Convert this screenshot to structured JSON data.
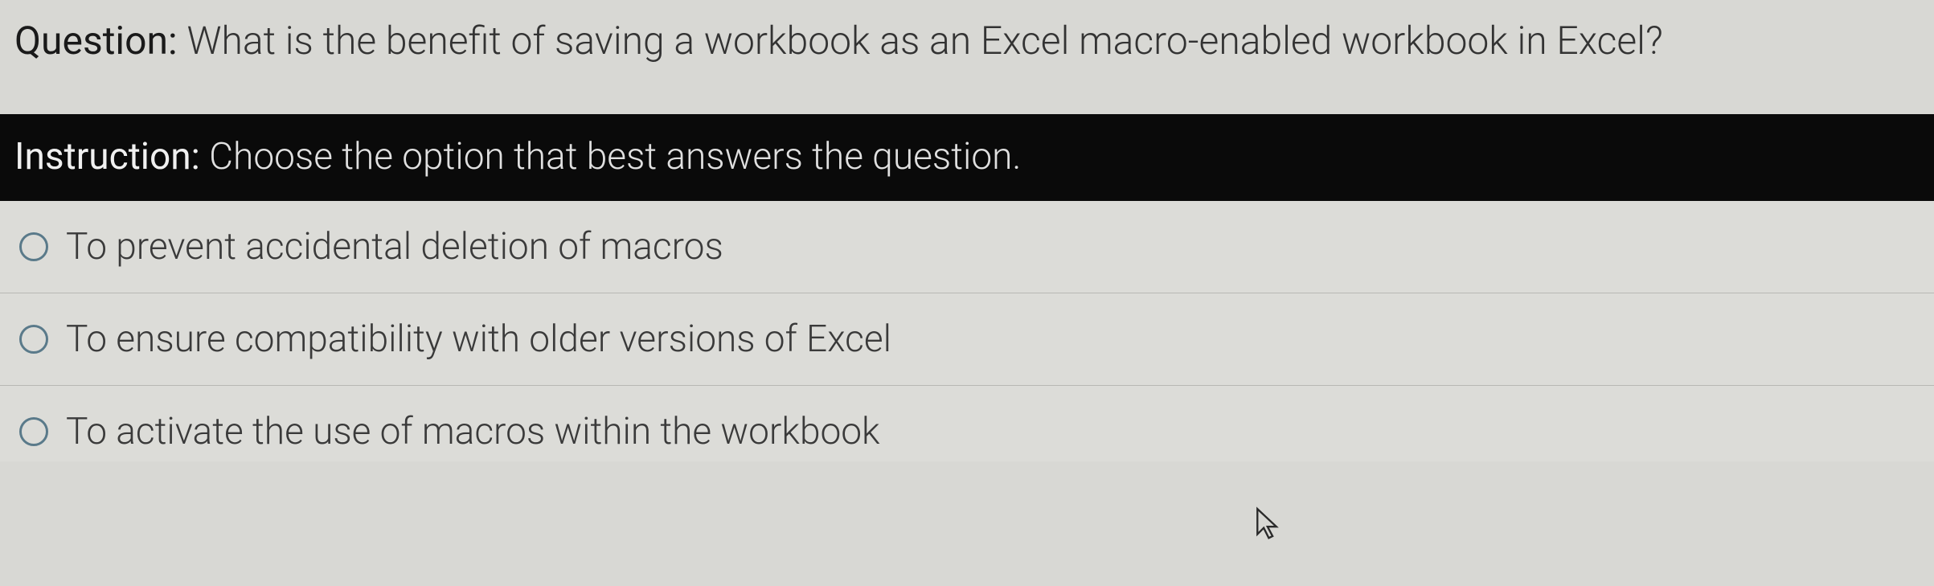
{
  "question": {
    "label": "Question:",
    "text": "What is the benefit of saving a workbook as an Excel macro-enabled workbook in Excel?"
  },
  "instruction": {
    "label": "Instruction:",
    "text": "Choose the option that best answers the question."
  },
  "options": [
    {
      "text": "To prevent accidental deletion of macros",
      "selected": false
    },
    {
      "text": "To ensure compatibility with older versions of Excel",
      "selected": false
    },
    {
      "text": "To activate the use of macros within the workbook",
      "selected": false
    }
  ]
}
